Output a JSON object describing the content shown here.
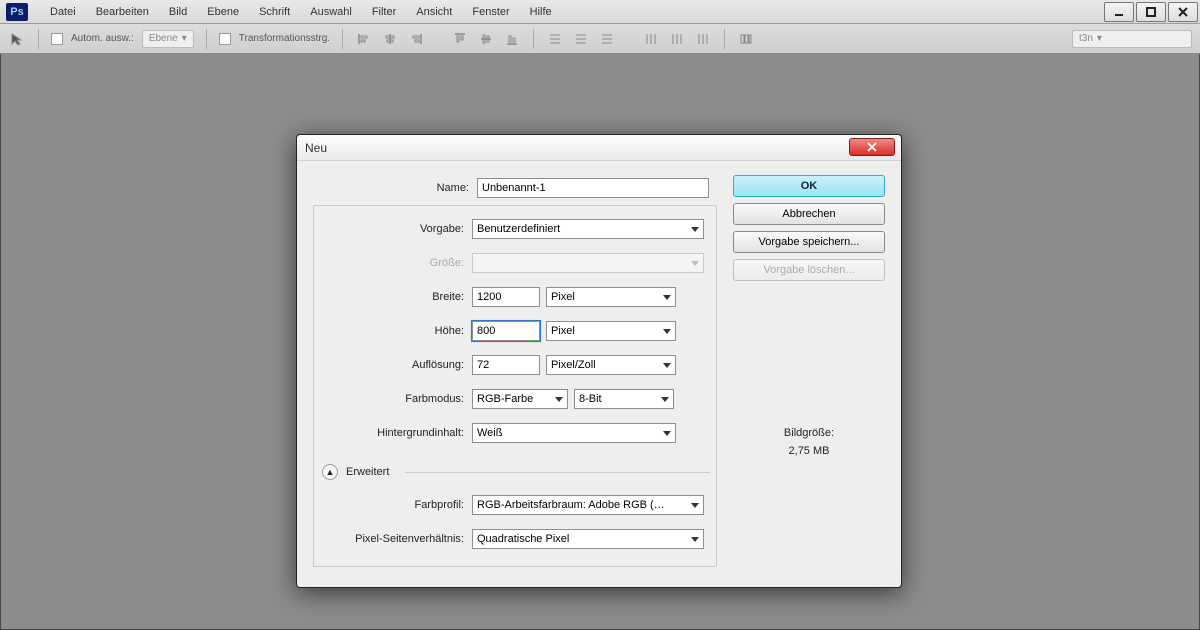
{
  "app": {
    "logo": "Ps"
  },
  "menu": [
    "Datei",
    "Bearbeiten",
    "Bild",
    "Ebene",
    "Schrift",
    "Auswahl",
    "Filter",
    "Ansicht",
    "Fenster",
    "Hilfe"
  ],
  "options": {
    "auto_label": "Autom. ausw.:",
    "layer_dd": "Ebene",
    "transform_label": "Transformationsstrg.",
    "workspace_dd": "t3n"
  },
  "dialog": {
    "title": "Neu",
    "labels": {
      "name": "Name:",
      "preset": "Vorgabe:",
      "size": "Größe:",
      "width": "Breite:",
      "height": "Höhe:",
      "resolution": "Auflösung:",
      "colormode": "Farbmodus:",
      "bgcontent": "Hintergrundinhalt:",
      "advanced": "Erweitert",
      "colorprofile": "Farbprofil:",
      "pixelaspect": "Pixel-Seitenverhältnis:"
    },
    "values": {
      "name": "Unbenannt-1",
      "preset": "Benutzerdefiniert",
      "size": "",
      "width": "1200",
      "width_unit": "Pixel",
      "height": "800",
      "height_unit": "Pixel",
      "resolution": "72",
      "resolution_unit": "Pixel/Zoll",
      "colormode": "RGB-Farbe",
      "bitdepth": "8-Bit",
      "bgcontent": "Weiß",
      "colorprofile": "RGB-Arbeitsfarbraum:  Adobe RGB (…",
      "pixelaspect": "Quadratische Pixel"
    },
    "buttons": {
      "ok": "OK",
      "cancel": "Abbrechen",
      "save_preset": "Vorgabe speichern...",
      "delete_preset": "Vorgabe löschen..."
    },
    "imagesize_label": "Bildgröße:",
    "imagesize_value": "2,75 MB"
  }
}
